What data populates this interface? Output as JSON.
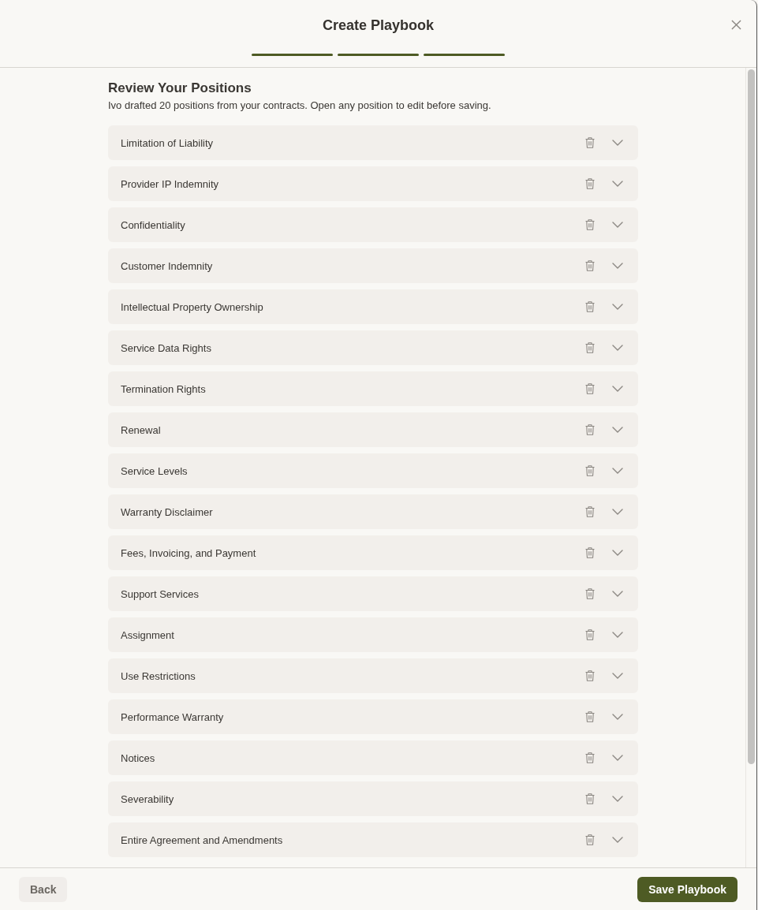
{
  "dialog": {
    "title": "Create Playbook",
    "steps": [
      {
        "complete": true
      },
      {
        "complete": true
      },
      {
        "complete": true
      }
    ]
  },
  "section": {
    "heading": "Review Your Positions",
    "description": "Ivo drafted 20 positions from your contracts. Open any position to edit before saving."
  },
  "positions": [
    {
      "label": "Limitation of Liability",
      "expanded": false
    },
    {
      "label": "Provider IP Indemnity",
      "expanded": false
    },
    {
      "label": "Confidentiality",
      "expanded": false
    },
    {
      "label": "Customer Indemnity",
      "expanded": false
    },
    {
      "label": "Intellectual Property Ownership",
      "expanded": false
    },
    {
      "label": "Service Data Rights",
      "expanded": false
    },
    {
      "label": "Termination Rights",
      "expanded": false
    },
    {
      "label": "Renewal",
      "expanded": false
    },
    {
      "label": "Service Levels",
      "expanded": false
    },
    {
      "label": "Warranty Disclaimer",
      "expanded": false
    },
    {
      "label": "Fees, Invoicing, and Payment",
      "expanded": false
    },
    {
      "label": "Support Services",
      "expanded": false
    },
    {
      "label": "Assignment",
      "expanded": false
    },
    {
      "label": "Use Restrictions",
      "expanded": false
    },
    {
      "label": "Performance Warranty",
      "expanded": false
    },
    {
      "label": "Notices",
      "expanded": false
    },
    {
      "label": "Severability",
      "expanded": false
    },
    {
      "label": "Entire Agreement and Amendments",
      "expanded": false
    }
  ],
  "footer": {
    "back_button": "Back",
    "save_button": "Save Playbook"
  }
}
